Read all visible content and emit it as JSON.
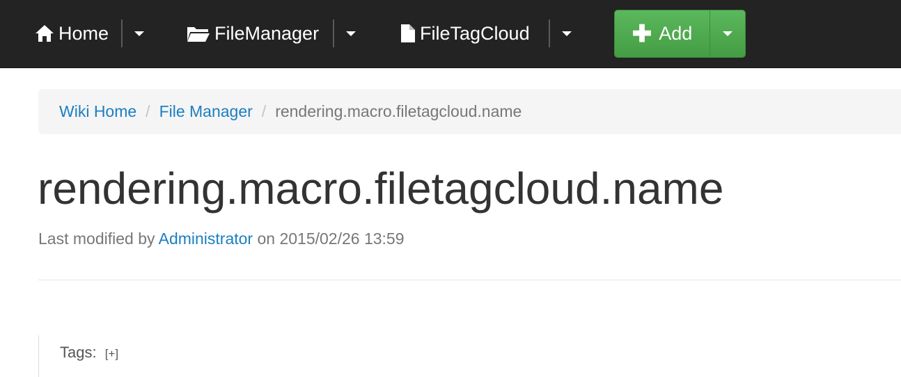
{
  "navbar": {
    "home": {
      "label": "Home",
      "icon": "home-icon"
    },
    "file_manager": {
      "label": "FileManager",
      "icon": "folder-open-icon"
    },
    "file_tag_cloud": {
      "label": "FileTagCloud",
      "icon": "file-icon"
    },
    "add": {
      "label": "Add",
      "icon": "plus-icon"
    }
  },
  "breadcrumb": {
    "items": [
      "Wiki Home",
      "File Manager"
    ],
    "current": "rendering.macro.filetagcloud.name",
    "separator": "/"
  },
  "page": {
    "title": "rendering.macro.filetagcloud.name",
    "modified_prefix": "Last modified by",
    "author": "Administrator",
    "modified_on": "on 2015/02/26 13:59"
  },
  "tags": {
    "label": "Tags:",
    "add_label": "[+]"
  },
  "colors": {
    "navbar_bg": "#232323",
    "add_button": "#5cb85c",
    "link": "#1b7ec2"
  }
}
